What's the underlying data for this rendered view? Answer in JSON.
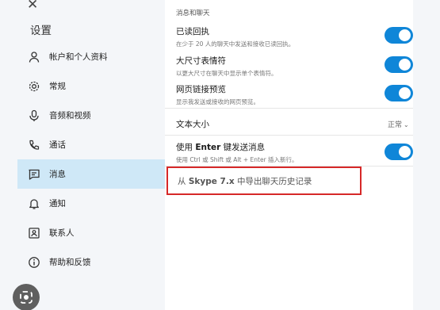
{
  "header": {
    "title": "设置",
    "close_glyph": "✕"
  },
  "nav": {
    "items": [
      {
        "label": "帐户和个人资料",
        "icon": "person-icon",
        "active": false
      },
      {
        "label": "常规",
        "icon": "gear-icon",
        "active": false
      },
      {
        "label": "音频和视频",
        "icon": "microphone-icon",
        "active": false
      },
      {
        "label": "通话",
        "icon": "phone-icon",
        "active": false
      },
      {
        "label": "消息",
        "icon": "message-icon",
        "active": true
      },
      {
        "label": "通知",
        "icon": "bell-icon",
        "active": false
      },
      {
        "label": "联系人",
        "icon": "contact-card-icon",
        "active": false
      },
      {
        "label": "帮助和反馈",
        "icon": "info-icon",
        "active": false
      }
    ]
  },
  "main": {
    "section_label": "消息和聊天",
    "settings": [
      {
        "title": "已读回执",
        "desc": "在少于 20 人的聊天中发送和接收已读回执。",
        "on": true
      },
      {
        "title": "大尺寸表情符",
        "desc": "以更大尺寸在聊天中显示单个表情符。",
        "on": true
      },
      {
        "title": "网页链接预览",
        "desc": "显示我发送或接收的网页预览。",
        "on": true
      }
    ],
    "text_size": {
      "label": "文本大小",
      "value": "正常",
      "chevron": "⌄"
    },
    "enter_send": {
      "title_pre": "使用",
      "title_key": "Enter",
      "title_post": "键发送消息",
      "desc": "使用 Ctrl 或 Shift 或 Alt + Enter 插入新行。",
      "on": true
    },
    "export": {
      "pre": "从",
      "product": "Skype 7.x",
      "post": "中导出聊天历史记录"
    }
  },
  "colors": {
    "accent": "#0f86d8",
    "active_bg": "#cfe8f7",
    "highlight_box": "#d62828"
  }
}
